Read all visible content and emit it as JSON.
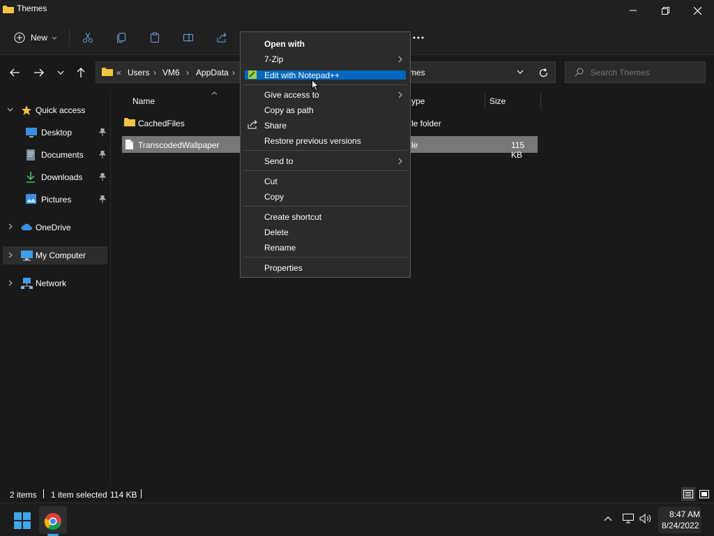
{
  "window": {
    "title": "Themes"
  },
  "toolbar": {
    "new_label": "New"
  },
  "address": {
    "overflow": "«",
    "crumbs": [
      "Users",
      "VM6",
      "AppData"
    ],
    "tail": "mes",
    "search_placeholder": "Search Themes"
  },
  "nav": {
    "quick_access": "Quick access",
    "desktop": "Desktop",
    "documents": "Documents",
    "downloads": "Downloads",
    "pictures": "Pictures",
    "onedrive": "OneDrive",
    "my_computer": "My Computer",
    "network": "Network"
  },
  "columns": {
    "name": "Name",
    "type": "ype",
    "size": "Size"
  },
  "files": [
    {
      "name": "CachedFiles",
      "type": "le folder",
      "size": ""
    },
    {
      "name": "TranscodedWallpaper",
      "type": "le",
      "size": "115 KB"
    }
  ],
  "context_menu": {
    "open_with": "Open with",
    "seven_zip": "7-Zip",
    "notepadpp": "Edit with Notepad++",
    "give_access": "Give access to",
    "copy_path": "Copy as path",
    "share": "Share",
    "restore": "Restore previous versions",
    "send_to": "Send to",
    "cut": "Cut",
    "copy": "Copy",
    "create_shortcut": "Create shortcut",
    "delete": "Delete",
    "rename": "Rename",
    "properties": "Properties"
  },
  "status": {
    "items": "2 items",
    "selected": "1 item selected",
    "size": "114 KB"
  },
  "taskbar": {
    "time": "8:47 AM",
    "date": "8/24/2022"
  },
  "colors": {
    "accent": "#0067c0",
    "selection": "#777777",
    "folder": "#f4c542",
    "background": "#191919"
  }
}
